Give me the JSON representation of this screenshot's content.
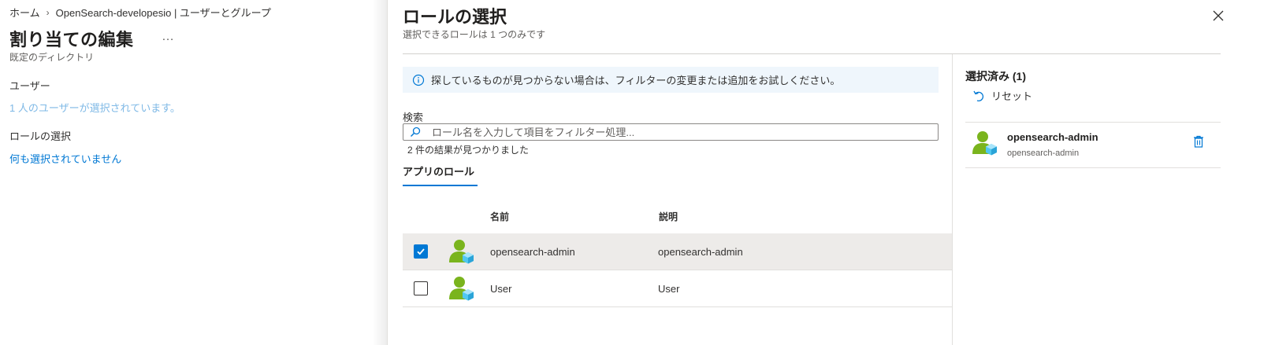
{
  "breadcrumb": {
    "home": "ホーム",
    "separator": "›",
    "current": "OpenSearch-developesio | ユーザーとグループ"
  },
  "page": {
    "title": "割り当ての編集",
    "more": "…",
    "subtitle": "既定のディレクトリ",
    "users_label": "ユーザー",
    "users_value": "1 人のユーザーが選択されています。",
    "role_label": "ロールの選択",
    "role_value": "何も選択されていません"
  },
  "panel": {
    "title": "ロールの選択",
    "subtitle": "選択できるロールは 1 つのみです",
    "info_text": "探しているものが見つからない場合は、フィルターの変更または追加をお試しください。",
    "search_label": "検索",
    "search_placeholder": "ロール名を入力して項目をフィルター処理...",
    "search_value": "",
    "results_text": "2 件の結果が見つかりました",
    "tab_label": "アプリのロール",
    "columns": {
      "name": "名前",
      "description": "説明"
    },
    "rows": [
      {
        "name": "opensearch-admin",
        "description": "opensearch-admin",
        "checked": true
      },
      {
        "name": "User",
        "description": "User",
        "checked": false
      }
    ]
  },
  "selected": {
    "title": "選択済み (1)",
    "reset_label": "リセット",
    "item": {
      "name": "opensearch-admin",
      "sub": "opensearch-admin"
    }
  },
  "colors": {
    "accent": "#0078d4",
    "info_bg": "#eff6fc",
    "selected_row_bg": "#edebe9",
    "avatar_green": "#7ab41d",
    "avatar_cube": "#50c8f0"
  },
  "icons": [
    "info-icon",
    "search-icon",
    "close-icon",
    "reset-icon",
    "trash-icon",
    "user-role-icon",
    "check-icon"
  ]
}
